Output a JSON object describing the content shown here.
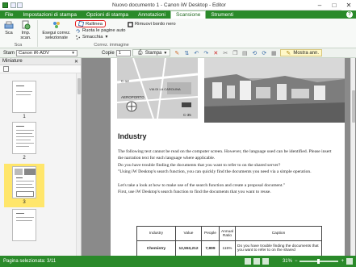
{
  "window": {
    "title": "Nuovo documento 1 - Canon iW Desktop - Editor",
    "close": "✕",
    "maximize": "□",
    "minimize": "–"
  },
  "tabs": [
    {
      "label": "File"
    },
    {
      "label": "Impostazioni di stampa"
    },
    {
      "label": "Opzioni di stampa"
    },
    {
      "label": "Annotazioni"
    },
    {
      "label": "Scansione"
    },
    {
      "label": "Strumenti"
    }
  ],
  "help": "?",
  "ribbon": {
    "sca_label": "Sca",
    "imp_scan_label": "Imp. scan.",
    "group_sca": "Sca",
    "esegui_label": "Esegui correz. selezionate",
    "rallinea_label": "Rallinea",
    "rimuovi_label": "Rimuovi bordo nero",
    "ruota_label": "Ruota le pagine auto",
    "smacchia_label": "Smacchia",
    "group_correz": "Correz. immagine"
  },
  "toolbar": {
    "stam_label": "Stam",
    "printer_value": "Canon iR-ADV",
    "copie_label": "Copie",
    "copie_value": "1",
    "stampa_label": "Stampa",
    "mostra_label": "Mostra ann."
  },
  "thumbpane": {
    "header": "Miniature",
    "pages": [
      {
        "num": "1"
      },
      {
        "num": "2"
      },
      {
        "num": "3"
      }
    ]
  },
  "document": {
    "heading": "Industry",
    "map_labels": {
      "c12": "C-12",
      "via": "VIA DI LA CAROLINA",
      "aeroporto": "AEROPORTO",
      "c35": "C-35"
    },
    "paragraphs": [
      "The following text cannot be read on the computer screen. However, the language used can be identified. Please insert the narration text for each language where applicable.",
      "Do you have trouble finding the documents that you want to refer to on the shared server?",
      "\"Using iW Desktop's search function, you can quickly find the documents you need via a simple operation.",
      "Let's take a look at how to make use of the search function and create a proposal document.\"",
      "First, use iW Desktop's search function to find the documents that you want to reuse."
    ],
    "table": {
      "headers": [
        "Industry",
        "Value",
        "People",
        "Annual Ratio",
        "Caption"
      ],
      "rows": [
        [
          "Chemistry",
          "12,553,212",
          "7,999",
          "115%",
          "Do you have trouble finding the documents that you want to refer to on the shared"
        ]
      ]
    }
  },
  "statusbar": {
    "page_info": "Pagina selezionata: 3/11",
    "zoom": "31%"
  }
}
